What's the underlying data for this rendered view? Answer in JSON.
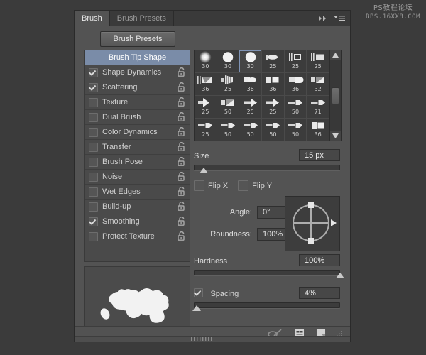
{
  "watermark": {
    "line1": "PS教程论坛",
    "line2": "BBS.16XX8.COM"
  },
  "panel": {
    "tabs": [
      {
        "label": "Brush",
        "active": true
      },
      {
        "label": "Brush Presets",
        "active": false
      }
    ],
    "header_icons": [
      {
        "name": "collapse-double-chevron-icon"
      },
      {
        "name": "panel-menu-icon"
      }
    ],
    "presets_button": "Brush Presets"
  },
  "options": [
    {
      "label": "Brush Tip Shape",
      "type": "header",
      "checked": false,
      "locked": false
    },
    {
      "label": "Shape Dynamics",
      "type": "item",
      "checked": true,
      "locked": false
    },
    {
      "label": "Scattering",
      "type": "item",
      "checked": true,
      "locked": false
    },
    {
      "label": "Texture",
      "type": "item",
      "checked": false,
      "locked": false
    },
    {
      "label": "Dual Brush",
      "type": "item",
      "checked": false,
      "locked": false
    },
    {
      "label": "Color Dynamics",
      "type": "item",
      "checked": false,
      "locked": false
    },
    {
      "label": "Transfer",
      "type": "item",
      "checked": false,
      "locked": false
    },
    {
      "label": "Brush Pose",
      "type": "item",
      "checked": false,
      "locked": false
    },
    {
      "label": "Noise",
      "type": "item",
      "checked": false,
      "locked": false
    },
    {
      "label": "Wet Edges",
      "type": "item",
      "checked": false,
      "locked": false
    },
    {
      "label": "Build-up",
      "type": "item",
      "checked": false,
      "locked": false
    },
    {
      "label": "Smoothing",
      "type": "item",
      "checked": true,
      "locked": false
    },
    {
      "label": "Protect Texture",
      "type": "item",
      "checked": false,
      "locked": false
    }
  ],
  "brush_grid": {
    "selected_index": 2,
    "rows": [
      [
        {
          "size": "30",
          "shape": "soft-round"
        },
        {
          "size": "30",
          "shape": "hard-round"
        },
        {
          "size": "30",
          "shape": "hard-round"
        },
        {
          "size": "25",
          "shape": "flat-tip"
        },
        {
          "size": "25",
          "shape": "bristle-a"
        },
        {
          "size": "25",
          "shape": "bristle-b"
        }
      ],
      [
        {
          "size": "36",
          "shape": "bristle-c"
        },
        {
          "size": "25",
          "shape": "fan"
        },
        {
          "size": "36",
          "shape": "round-blunt"
        },
        {
          "size": "36",
          "shape": "square-blunt"
        },
        {
          "size": "36",
          "shape": "round-curve"
        },
        {
          "size": "32",
          "shape": "angle-flat"
        }
      ],
      [
        {
          "size": "25",
          "shape": "cone"
        },
        {
          "size": "50",
          "shape": "angle-flat"
        },
        {
          "size": "25",
          "shape": "arrow-flat"
        },
        {
          "size": "25",
          "shape": "arrow-flat"
        },
        {
          "size": "50",
          "shape": "pencil"
        },
        {
          "size": "71",
          "shape": "pencil"
        }
      ],
      [
        {
          "size": "25",
          "shape": "pencil"
        },
        {
          "size": "50",
          "shape": "pencil"
        },
        {
          "size": "50",
          "shape": "pencil"
        },
        {
          "size": "50",
          "shape": "pencil"
        },
        {
          "size": "50",
          "shape": "pencil"
        },
        {
          "size": "36",
          "shape": "square-blunt"
        }
      ]
    ]
  },
  "controls": {
    "size": {
      "label": "Size",
      "value": "15 px",
      "slider_pct": 7
    },
    "flip_x": {
      "label": "Flip X",
      "checked": false
    },
    "flip_y": {
      "label": "Flip Y",
      "checked": false
    },
    "angle": {
      "label": "Angle:",
      "value": "0°"
    },
    "roundness": {
      "label": "Roundness:",
      "value": "100%"
    },
    "hardness": {
      "label": "Hardness",
      "value": "100%",
      "slider_pct": 100
    },
    "spacing": {
      "label": "Spacing",
      "value": "4%",
      "checked": true,
      "slider_pct": 2
    }
  },
  "bottom_icons": [
    {
      "name": "toggle-airbrush-icon"
    },
    {
      "name": "brush-preset-panel-icon"
    },
    {
      "name": "new-brush-icon"
    }
  ]
}
